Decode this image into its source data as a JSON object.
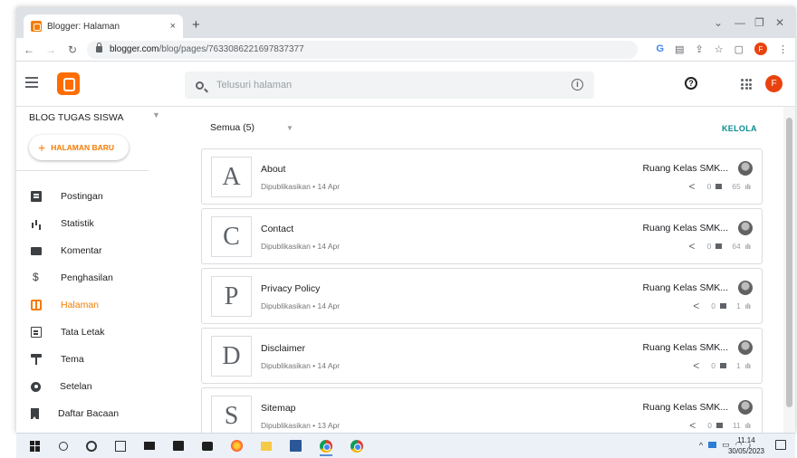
{
  "browser": {
    "tab_title": "Blogger: Halaman",
    "tab_close": "×",
    "new_tab": "+",
    "url_domain": "blogger.com",
    "url_path": "/blog/pages/7633086221697837377",
    "win_min": "—",
    "win_restore": "❐",
    "win_close": "✕",
    "win_caret": "⌄",
    "profile_initial": "F"
  },
  "header": {
    "search_placeholder": "Telusuri halaman",
    "info_label": "i",
    "help_label": "?",
    "avatar_initial": "F"
  },
  "sidebar": {
    "blog_name": "BLOG TUGAS SISWA",
    "new_page_label": "HALAMAN BARU",
    "new_page_plus": "+",
    "items": [
      {
        "label": "Postingan",
        "icon": "posts-icon",
        "active": false
      },
      {
        "label": "Statistik",
        "icon": "stats-icon",
        "active": false
      },
      {
        "label": "Komentar",
        "icon": "comment-icon",
        "active": false
      },
      {
        "label": "Penghasilan",
        "icon": "dollar-icon",
        "active": false
      },
      {
        "label": "Halaman",
        "icon": "pages-icon",
        "active": true
      },
      {
        "label": "Tata Letak",
        "icon": "layout-icon",
        "active": false
      },
      {
        "label": "Tema",
        "icon": "theme-icon",
        "active": false
      },
      {
        "label": "Setelan",
        "icon": "gear-icon",
        "active": false
      },
      {
        "label": "Daftar Bacaan",
        "icon": "bookmark-icon",
        "active": false
      }
    ]
  },
  "main": {
    "filter_label": "Semua (5)",
    "manage_label": "KELOLA",
    "pages": [
      {
        "letter": "A",
        "title": "About",
        "status": "Dipublikasikan • 14 Apr",
        "author": "Ruang Kelas SMK...",
        "comments": "0",
        "views": "65"
      },
      {
        "letter": "C",
        "title": "Contact",
        "status": "Dipublikasikan • 14 Apr",
        "author": "Ruang Kelas SMK...",
        "comments": "0",
        "views": "64"
      },
      {
        "letter": "P",
        "title": "Privacy Policy",
        "status": "Dipublikasikan • 14 Apr",
        "author": "Ruang Kelas SMK...",
        "comments": "0",
        "views": "1"
      },
      {
        "letter": "D",
        "title": "Disclaimer",
        "status": "Dipublikasikan • 14 Apr",
        "author": "Ruang Kelas SMK...",
        "comments": "0",
        "views": "1"
      },
      {
        "letter": "S",
        "title": "Sitemap",
        "status": "Dipublikasikan • 13 Apr",
        "author": "Ruang Kelas SMK...",
        "comments": "0",
        "views": "11"
      }
    ]
  },
  "taskbar": {
    "time": "11.14",
    "date": "30/05/2023",
    "tray_caret": "^"
  },
  "colors": {
    "accent": "#f57c00",
    "manage": "#0b8a8f"
  }
}
